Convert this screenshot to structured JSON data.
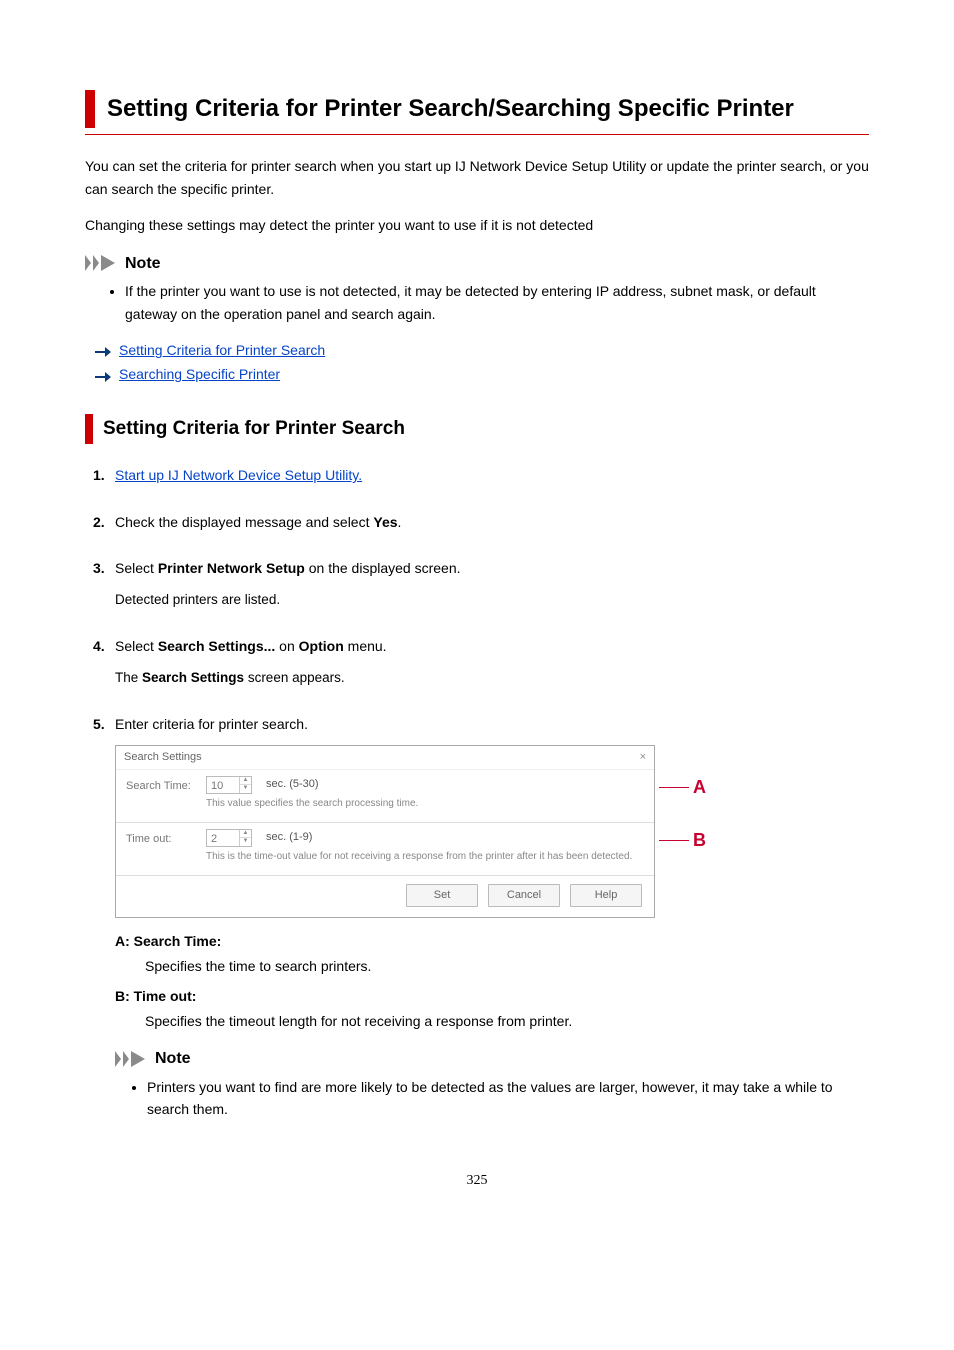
{
  "title": "Setting Criteria for Printer Search/Searching Specific Printer",
  "intro1": "You can set the criteria for printer search when you start up IJ Network Device Setup Utility or update the printer search, or you can search the specific printer.",
  "intro2": "Changing these settings may detect the printer you want to use if it is not detected",
  "note_label": "Note",
  "note1": "If the printer you want to use is not detected, it may be detected by entering IP address, subnet mask, or default gateway on the operation panel and search again.",
  "links": {
    "l1": "Setting Criteria for Printer Search",
    "l2": "Searching Specific Printer"
  },
  "section_title": "Setting Criteria for Printer Search",
  "steps": {
    "s1": "Start up IJ Network Device Setup Utility.",
    "s2_a": "Check the displayed message and select ",
    "s2_b": "Yes",
    "s2_c": ".",
    "s3_a": "Select ",
    "s3_b": "Printer Network Setup",
    "s3_c": " on the displayed screen.",
    "s3_sub": "Detected printers are listed.",
    "s4_a": "Select ",
    "s4_b": "Search Settings...",
    "s4_c": " on ",
    "s4_d": "Option",
    "s4_e": " menu.",
    "s4_sub_a": "The ",
    "s4_sub_b": "Search Settings",
    "s4_sub_c": " screen appears.",
    "s5": "Enter criteria for printer search."
  },
  "dialog": {
    "title": "Search Settings",
    "close": "×",
    "row1_label": "Search Time:",
    "row1_value": "10",
    "row1_unit": "sec. (5-30)",
    "row1_hint": "This value specifies the search processing time.",
    "row2_label": "Time out:",
    "row2_value": "2",
    "row2_unit": "sec. (1-9)",
    "row2_hint": "This is the time-out value for not receiving a response from the printer after it has been detected.",
    "btn_set": "Set",
    "btn_cancel": "Cancel",
    "btn_help": "Help"
  },
  "annot": {
    "a": "A",
    "b": "B"
  },
  "descr": {
    "a_label": "A: Search Time:",
    "a_text": "Specifies the time to search printers.",
    "b_label": "B: Time out:",
    "b_text": "Specifies the timeout length for not receiving a response from printer."
  },
  "inner_note": "Printers you want to find are more likely to be detected as the values are larger, however, it may take a while to search them.",
  "page_num": "325"
}
